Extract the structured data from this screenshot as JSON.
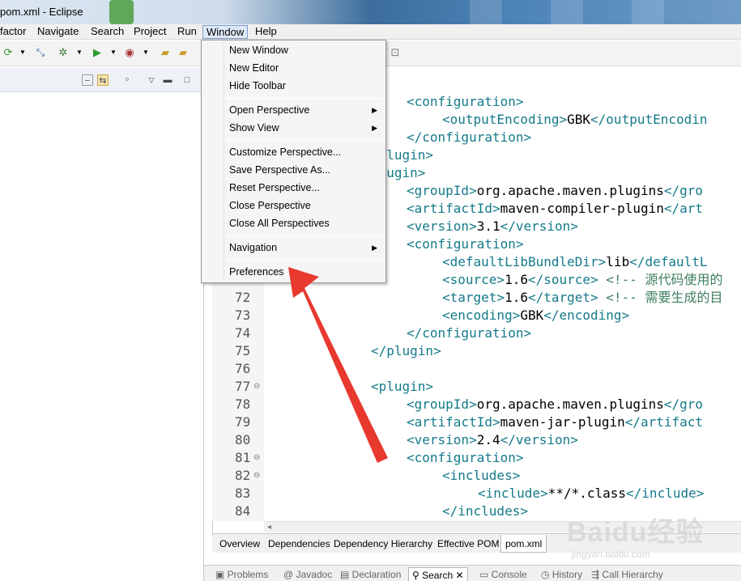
{
  "window": {
    "title": "pom.xml - Eclipse"
  },
  "menubar": [
    {
      "label": "factor"
    },
    {
      "label": "Navigate"
    },
    {
      "label": "Search"
    },
    {
      "label": "Project"
    },
    {
      "label": "Run"
    },
    {
      "label": "Window"
    },
    {
      "label": "Help"
    }
  ],
  "window_menu": {
    "group1": [
      "New Window",
      "New Editor",
      "Hide Toolbar"
    ],
    "group2": [
      "Open Perspective",
      "Show View"
    ],
    "group3": [
      "Customize Perspective...",
      "Save Perspective As...",
      "Reset Perspective...",
      "Close Perspective",
      "Close All Perspectives"
    ],
    "group4": [
      "Navigation"
    ],
    "group5": [
      "Preferences"
    ]
  },
  "editor": {
    "line_numbers": [
      "72",
      "73",
      "74",
      "75",
      "76",
      "77",
      "78",
      "79",
      "80",
      "81",
      "82",
      "83",
      "84"
    ],
    "lines": [
      {
        "parts": [
          [
            "tag",
            "<configuration>"
          ]
        ]
      },
      {
        "parts": [
          [
            "tag",
            "<outputEncoding>"
          ],
          [
            "txt",
            "GBK"
          ],
          [
            "tag",
            "</outputEncodin"
          ]
        ]
      },
      {
        "parts": [
          [
            "tag",
            "</configuration>"
          ]
        ]
      },
      {
        "parts": [
          [
            "tag",
            "/plugin>"
          ]
        ]
      },
      {
        "parts": [
          [
            "tag",
            "plugin>"
          ]
        ]
      },
      {
        "parts": [
          [
            "tag",
            "<groupId>"
          ],
          [
            "txt",
            "org.apache.maven.plugins"
          ],
          [
            "tag",
            "</gro"
          ]
        ]
      },
      {
        "parts": [
          [
            "tag",
            "<artifactId>"
          ],
          [
            "txt",
            "maven-compiler-plugin"
          ],
          [
            "tag",
            "</art"
          ]
        ]
      },
      {
        "parts": [
          [
            "tag",
            "<version>"
          ],
          [
            "txt",
            "3.1"
          ],
          [
            "tag",
            "</version>"
          ]
        ]
      },
      {
        "parts": [
          [
            "tag",
            "<configuration>"
          ]
        ]
      },
      {
        "parts": [
          [
            "tag",
            "<defaultLibBundleDir>"
          ],
          [
            "txt",
            "lib"
          ],
          [
            "tag",
            "</defaultL"
          ]
        ]
      },
      {
        "parts": [
          [
            "tag",
            "<source>"
          ],
          [
            "txt",
            "1.6"
          ],
          [
            "tag",
            "</source> "
          ],
          [
            "cmt",
            "<!-- 源代码使用的"
          ]
        ]
      },
      {
        "parts": [
          [
            "tag",
            "<target>"
          ],
          [
            "txt",
            "1.6"
          ],
          [
            "tag",
            "</target> "
          ],
          [
            "cmt",
            "<!-- 需要生成的目"
          ]
        ]
      },
      {
        "parts": [
          [
            "tag",
            "<encoding>"
          ],
          [
            "txt",
            "GBK"
          ],
          [
            "tag",
            "</encoding>"
          ]
        ]
      },
      {
        "parts": [
          [
            "tag",
            "</configuration>"
          ]
        ]
      },
      {
        "parts": [
          [
            "tag",
            "</plugin>"
          ]
        ]
      },
      {
        "parts": []
      },
      {
        "parts": [
          [
            "tag",
            "<plugin>"
          ]
        ]
      },
      {
        "parts": [
          [
            "tag",
            "<groupId>"
          ],
          [
            "txt",
            "org.apache.maven.plugins"
          ],
          [
            "tag",
            "</gro"
          ]
        ]
      },
      {
        "parts": [
          [
            "tag",
            "<artifactId>"
          ],
          [
            "txt",
            "maven-jar-plugin"
          ],
          [
            "tag",
            "</artifact"
          ]
        ]
      },
      {
        "parts": [
          [
            "tag",
            "<version>"
          ],
          [
            "txt",
            "2.4"
          ],
          [
            "tag",
            "</version>"
          ]
        ]
      },
      {
        "parts": [
          [
            "tag",
            "<configuration>"
          ]
        ]
      },
      {
        "parts": [
          [
            "tag",
            "<includes>"
          ]
        ]
      },
      {
        "parts": [
          [
            "tag",
            "<include>"
          ],
          [
            "txt",
            "**/*.class"
          ],
          [
            "tag",
            "</include> "
          ]
        ]
      },
      {
        "parts": [
          [
            "tag",
            "</includes>"
          ]
        ]
      }
    ]
  },
  "editor_tabs": [
    "Overview",
    "Dependencies",
    "Dependency Hierarchy",
    "Effective POM",
    "pom.xml"
  ],
  "bottom_tabs": [
    "Problems",
    "@ Javadoc",
    "Declaration",
    "Search",
    "Console",
    "History",
    "Call Hierarchy"
  ],
  "watermark": {
    "main": "Baidu经验",
    "sub": "jingyan.baidu.com"
  },
  "colors": {
    "xml_tag": "#157a8a",
    "arrow": "#e8392f",
    "menu_highlight": "#dde8f7"
  }
}
